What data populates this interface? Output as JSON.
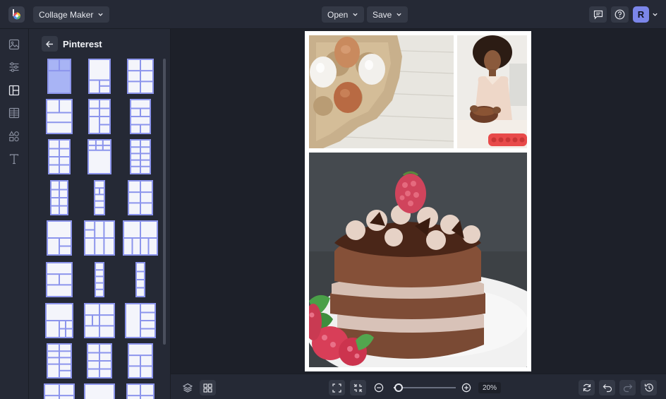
{
  "topbar": {
    "app_menu_label": "Collage Maker",
    "open_label": "Open",
    "save_label": "Save",
    "avatar_initial": "R",
    "icons": [
      "logo-icon",
      "comment-icon",
      "help-icon",
      "chevron-down-icon"
    ]
  },
  "rail": {
    "items": [
      {
        "name": "image-icon",
        "active": false
      },
      {
        "name": "adjust-sliders-icon",
        "active": false
      },
      {
        "name": "layout-icon",
        "active": true
      },
      {
        "name": "texture-icon",
        "active": false
      },
      {
        "name": "shapes-icon",
        "active": false
      },
      {
        "name": "text-icon",
        "active": false
      }
    ]
  },
  "panel": {
    "title": "Pinterest",
    "selected_layout": 1,
    "layout_count": 24
  },
  "canvas": {
    "photos": [
      "eggs-in-carton",
      "child-baking",
      "chocolate-cake-with-raspberry"
    ]
  },
  "bottombar": {
    "zoom_value": "20%",
    "zoom_fraction": 0.08,
    "icons": [
      "layers-icon",
      "grid-icon",
      "fit-screen-icon",
      "shrink-icon",
      "zoom-out-icon",
      "zoom-in-icon",
      "refresh-icon",
      "undo-icon",
      "redo-icon",
      "history-icon"
    ]
  },
  "colors": {
    "background": "#1d2029",
    "panel": "#252935",
    "accent": "#8c95ec",
    "avatar": "#7b86e9"
  }
}
